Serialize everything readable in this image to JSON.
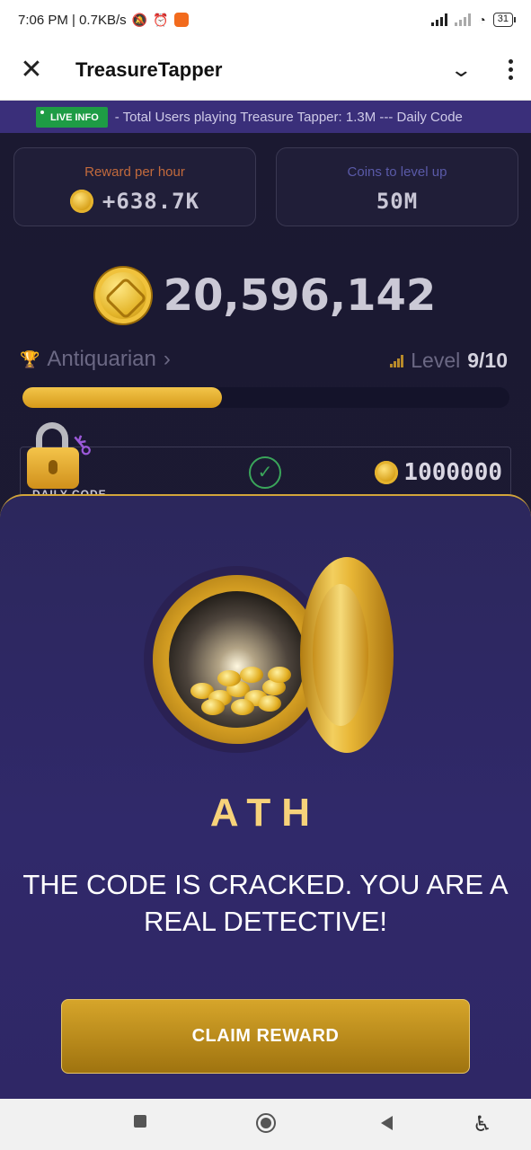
{
  "status_bar": {
    "time_speed": "7:06 PM | 0.7KB/s",
    "battery": "31"
  },
  "app_bar": {
    "title": "TreasureTapper",
    "close_icon": "close-icon",
    "expand_icon": "chevron-down-icon",
    "menu_icon": "more-vertical-icon"
  },
  "ticker": {
    "badge": "LIVE INFO",
    "text": "- Total Users playing Treasure Tapper:  1.3M --- Daily Code"
  },
  "stats": {
    "reward_label": "Reward per hour",
    "reward_value": "+638.7K",
    "levelup_label": "Coins to level up",
    "levelup_value": "50M"
  },
  "balance": "20,596,142",
  "rank": {
    "name": "Antiquarian",
    "arrow": "›",
    "level_label": "Level",
    "level_value": "9/10",
    "progress": 0.41
  },
  "daily": {
    "label": "DAILY CODE",
    "check": "✓",
    "amount": "1000000"
  },
  "modal": {
    "code": "ATH",
    "message": "THE CODE IS CRACKED. YOU ARE A REAL DETECTIVE!",
    "button": "CLAIM REWARD"
  },
  "colors": {
    "accent_gold": "#d6a52a",
    "sheet_bg": "#2c275c",
    "live_green": "#1e9c45"
  }
}
